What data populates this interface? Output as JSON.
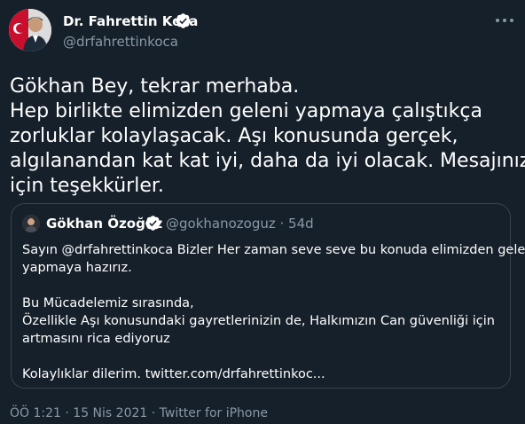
{
  "author": {
    "name": "Dr. Fahrettin Koca",
    "handle": "@drfahrettinkoca"
  },
  "tweet": {
    "lines": [
      "Gökhan Bey, tekrar merhaba.",
      "Hep birlikte elimizden geleni yapmaya çalıştıkça",
      "zorluklar kolaylaşacak. Aşı konusunda gerçek,",
      "algılanandan kat kat iyi, daha da iyi olacak. Mesajınız",
      "için teşekkürler."
    ]
  },
  "quote": {
    "name": "Gökhan Özoğuz",
    "meta": "@gokhanozoguz · 54d",
    "lines": [
      "Sayın @drfahrettinkoca Bizler Her zaman seve seve bu konuda elimizden geleni",
      "yapmaya hazırız.",
      "",
      "Bu Mücadelemiz sırasında,",
      "Özellikle Aşı konusundaki gayretlerinizin de, Halkımızın Can güvenliği için",
      "artmasını rica ediyoruz",
      "",
      "Kolaylıklar dilerim. twitter.com/drfahrettinkoc..."
    ]
  },
  "footer": {
    "time": "ÖÖ 1:21",
    "separator": "·",
    "date": "15 Nis 2021",
    "source": "Twitter for iPhone"
  },
  "colors": {
    "background": "#15202b",
    "secondary_text": "#8899a6",
    "verified_badge": "#ffffff",
    "card_border": "#38444d"
  },
  "icons": {
    "verified": "verified-badge-icon",
    "more": "more-icon"
  }
}
